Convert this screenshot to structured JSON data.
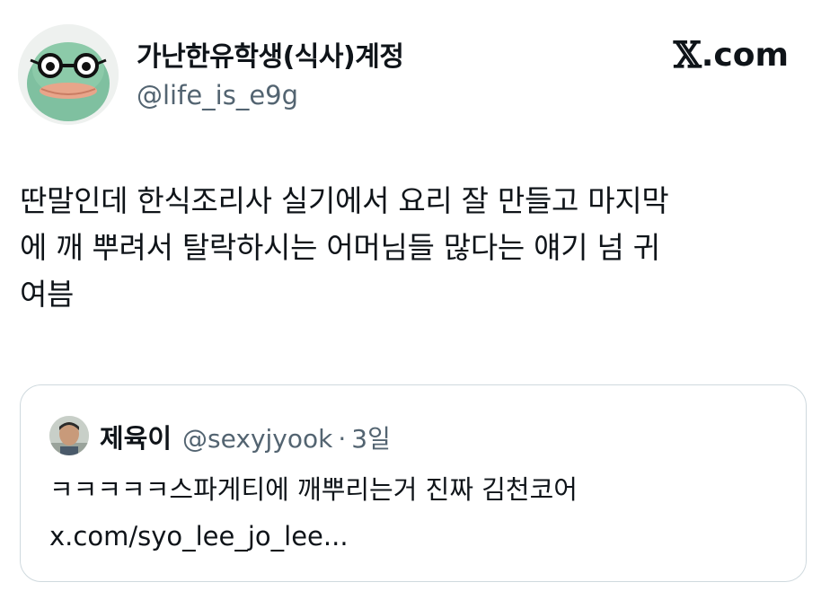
{
  "author": {
    "display_name": "가난한유학생(식사)계정",
    "handle": "@life_is_e9g"
  },
  "brand": {
    "logo_glyph": "𝕏",
    "domain_suffix": ".com"
  },
  "tweet": {
    "text": "딴말인데 한식조리사 실기에서 요리 잘 만들고 마지막\n에 깨 뿌려서 탈락하시는 어머님들 많다는 얘기 넘 귀\n여븜"
  },
  "quoted_tweet": {
    "display_name": "제육이",
    "handle": "@sexyjyook",
    "separator": "·",
    "time": "3일",
    "text": "ㅋㅋㅋㅋㅋ스파게티에 깨뿌리는거 진짜 김천코어\nx.com/syo_lee_jo_lee..."
  },
  "colors": {
    "text_primary": "#0f1419",
    "text_secondary": "#536471",
    "border": "#cfd9de"
  },
  "icons": {
    "author_avatar": "frog-with-glasses-avatar",
    "quoted_avatar": "person-photo-avatar",
    "brand_logo": "x-logo-icon"
  }
}
